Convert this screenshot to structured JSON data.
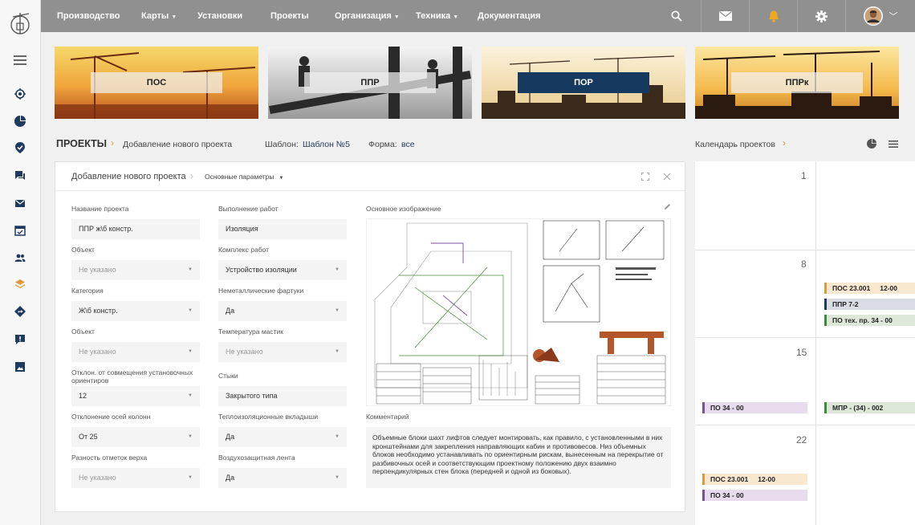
{
  "nav": {
    "items": [
      {
        "label": "Производство",
        "dropdown": false
      },
      {
        "label": "Карты",
        "dropdown": true
      },
      {
        "label": "Установки",
        "dropdown": false
      },
      {
        "label": "Проекты",
        "dropdown": false
      },
      {
        "label": "Организация",
        "dropdown": true
      },
      {
        "label": "Техника",
        "dropdown": true
      },
      {
        "label": "Документация",
        "dropdown": false
      }
    ],
    "icons": [
      "search-icon",
      "mail-icon",
      "bell-icon",
      "gear-icon",
      "avatar"
    ]
  },
  "sidebar": {
    "icons": [
      "target-icon",
      "pie-chart-icon",
      "check-shield-icon",
      "chat-icon",
      "mail-icon",
      "calendar-icon",
      "users-icon",
      "layers-icon",
      "diamond-arrow-icon",
      "alert-icon",
      "image-icon"
    ],
    "active_index": 7
  },
  "banners": [
    {
      "label": "ПОС",
      "active": false
    },
    {
      "label": "ППР",
      "active": false
    },
    {
      "label": "ПОР",
      "active": true
    },
    {
      "label": "ППРк",
      "active": false
    }
  ],
  "breadcrumb": {
    "root": "ПРОЕКТЫ",
    "current": "Добавление нового проекта",
    "template_label": "Шаблон:",
    "template_value": "Шаблон №5",
    "form_label": "Форма:",
    "form_value": "все",
    "calendar_label": "Календарь проектов"
  },
  "panel": {
    "title": "Добавление нового проекта",
    "section": "Основные параметры",
    "left_fields": [
      {
        "label": "Название проекта",
        "value": "ППР ж\\б констр.",
        "select": false,
        "placeholder": false
      },
      {
        "label": "Объект",
        "value": "Не указано",
        "select": true,
        "placeholder": true
      },
      {
        "label": "Категория",
        "value": "Ж\\б констр.",
        "select": true,
        "placeholder": false
      },
      {
        "label": "Объект",
        "value": "Не указано",
        "select": true,
        "placeholder": true
      },
      {
        "label": "Отклон. от совмещения установочных ориентиров",
        "value": "12",
        "select": true,
        "placeholder": false
      },
      {
        "label": "Отклонение осей колонн",
        "value": "От 25",
        "select": true,
        "placeholder": false
      },
      {
        "label": "Разность отметок верха",
        "value": "Не указано",
        "select": true,
        "placeholder": true
      }
    ],
    "mid_fields": [
      {
        "label": "Выполнение работ",
        "value": "Изоляция",
        "select": false,
        "placeholder": false
      },
      {
        "label": "Комплекс работ",
        "value": "Устройство изоляции",
        "select": true,
        "placeholder": false
      },
      {
        "label": "Неметаллические  фартуки",
        "value": "Да",
        "select": true,
        "placeholder": false
      },
      {
        "label": "Температура мастик",
        "value": "Не указано",
        "select": true,
        "placeholder": true
      },
      {
        "label": "Стыки",
        "value": "Закрытого типа",
        "select": false,
        "placeholder": false
      },
      {
        "label": "Теплоизоляционные вкладыши",
        "value": "Да",
        "select": true,
        "placeholder": false
      },
      {
        "label": "Воздухозащитная лента",
        "value": "Да",
        "select": true,
        "placeholder": false
      }
    ],
    "image_label": "Основное изображение",
    "comment_label": "Комментарий",
    "comment": "Объемные блоки шахт лифтов следует монтировать, как правило, с установленными в них кронштейнами для закрепления направляющих кабин и противовесов. Низ объемных блоков необходимо устанавливать по ориентирным рискам, вынесенным на перекрытие от разбивочных осей и соответствующим проектному положению двух взаимно перпендикулярных стен блока (передней и одной из боковых)."
  },
  "calendar": {
    "days": [
      "1",
      "8",
      "15",
      "22"
    ],
    "events": [
      {
        "label": "ПОС 23.001",
        "time": "12-00",
        "color": "#e09a3c",
        "bg": "#f8e8d0"
      },
      {
        "label": "ППР 7-2",
        "time": "",
        "color": "#1f3a5f",
        "bg": "#d9dde3"
      },
      {
        "label": "ПО тех. пр.  34 - 00",
        "time": "",
        "color": "#3a8a3a",
        "bg": "#dde8d9"
      },
      {
        "label": "ПО  34 - 00",
        "time": "",
        "color": "#7a4fa0",
        "bg": "#e6dcee"
      },
      {
        "label": "МПР - (34) - 002",
        "time": "",
        "color": "#3a8a3a",
        "bg": "#dde8d9"
      },
      {
        "label": "ПОС 23.001",
        "time": "12-00",
        "color": "#e09a3c",
        "bg": "#f8e8d0"
      },
      {
        "label": "ПО  34 - 00",
        "time": "",
        "color": "#7a4fa0",
        "bg": "#e6dcee"
      }
    ]
  }
}
